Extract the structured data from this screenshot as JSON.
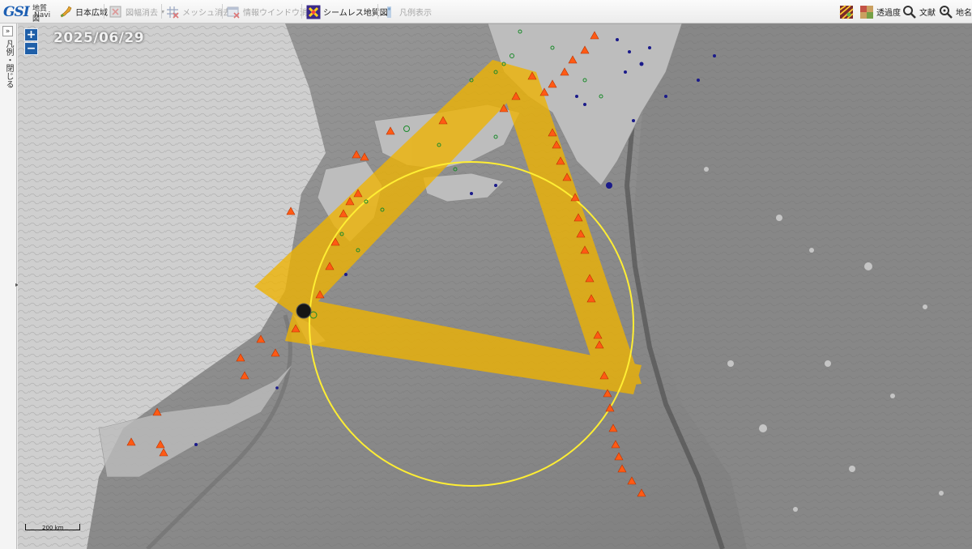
{
  "toolbar": {
    "logo": {
      "mark": "GSI",
      "line1": "地質図",
      "line2": "Navi"
    },
    "left_items": [
      {
        "label": "日本広域",
        "icon": "japan-map-icon",
        "enabled": true
      },
      {
        "label": "図幅消去",
        "icon": "sheet-clear-icon",
        "enabled": false,
        "dropdown": "▾"
      },
      {
        "label": "メッシュ消去",
        "icon": "mesh-clear-icon",
        "enabled": false
      },
      {
        "label": "情報ウインドウ消去",
        "icon": "info-window-clear-icon",
        "enabled": false
      },
      {
        "label": "シームレス地質図",
        "icon": "seamless-geology-icon",
        "enabled": true
      },
      {
        "label": "凡例表示",
        "icon": "legend-icon",
        "enabled": false
      }
    ],
    "right_items": [
      {
        "label": "",
        "icon": "layers-icon"
      },
      {
        "label": "透過度",
        "icon": "transparency-icon"
      },
      {
        "label": "文献",
        "icon": "literature-search-icon"
      },
      {
        "label": "地名",
        "icon": "place-search-icon"
      }
    ]
  },
  "side_panel": {
    "toggle": "»",
    "label": "凡例・閉じる",
    "grip": "▸"
  },
  "map": {
    "date": "2025/06/29",
    "zoom_in": "+",
    "zoom_out": "−",
    "scale_label": "200 km",
    "colors": {
      "ocean": "#8e8e8e",
      "land": "#c4c4c4",
      "overlay": "#f0b400",
      "circle": "#ffee33",
      "volcano": "#ff5a14",
      "quake_green": "#1a8a2a",
      "quake_blue": "#1a1a8a"
    },
    "symbols": {
      "volcanoes": "triangle-icon",
      "earthquakes": "circle-icon",
      "highlighted_event": "dark-circle-icon"
    }
  }
}
